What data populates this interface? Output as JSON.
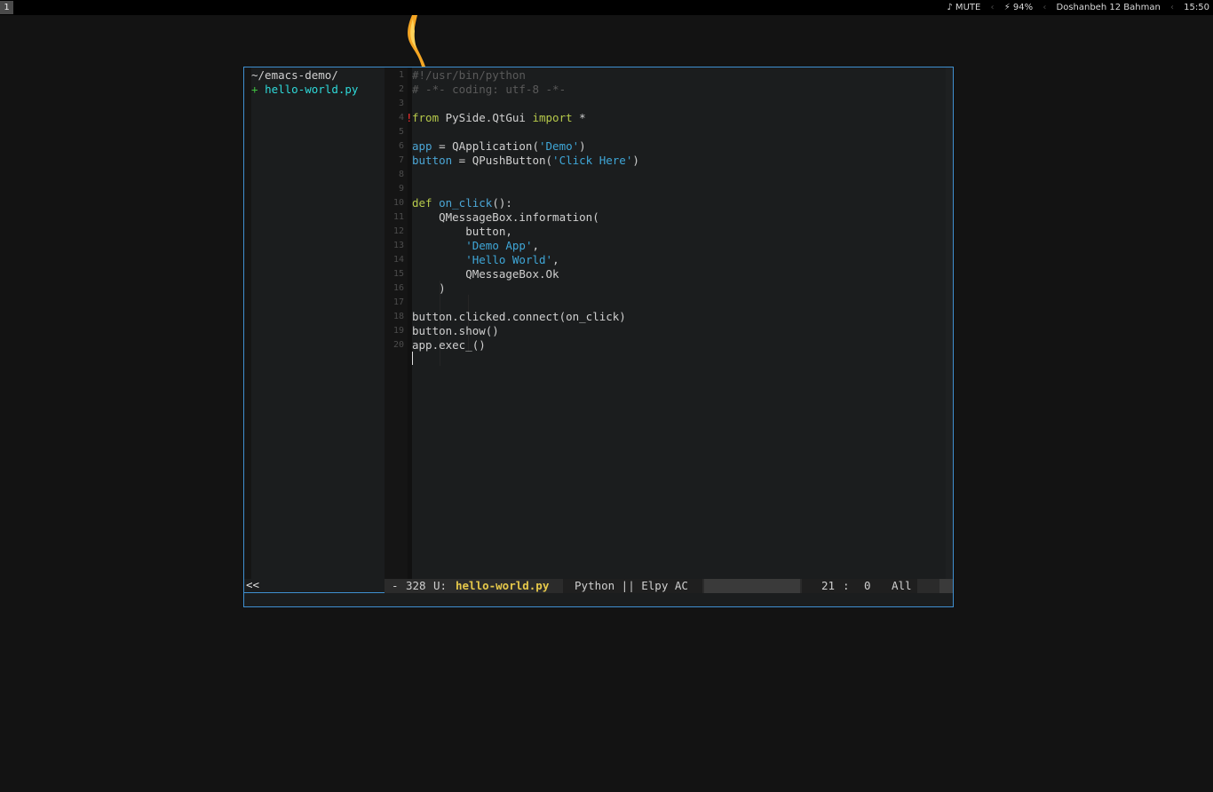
{
  "topbar": {
    "workspace": "1",
    "sound": "♪ MUTE",
    "battery": "⚡ 94%",
    "date": "Doshanbeh 12 Bahman",
    "time": "15:50",
    "separator": "‹"
  },
  "sidebar": {
    "path": "~/emacs-demo/",
    "file_marker": "+",
    "file_name": "hello-world.py",
    "toggle_label": "<<"
  },
  "editor": {
    "line_numbers": [
      "1",
      "2",
      "3",
      "4",
      "5",
      "6",
      "7",
      "8",
      "9",
      "10",
      "11",
      "12",
      "13",
      "14",
      "15",
      "16",
      "17",
      "18",
      "19",
      "20"
    ],
    "error_marker": "!",
    "lines": [
      {
        "parts": [
          {
            "t": "#!/usr/bin/python",
            "c": "cm"
          }
        ]
      },
      {
        "parts": [
          {
            "t": "# -*- coding: utf-8 -*-",
            "c": "cm"
          }
        ]
      },
      {
        "parts": []
      },
      {
        "parts": [
          {
            "t": "from",
            "c": "kw"
          },
          {
            "t": " PySide.QtGui ",
            "c": ""
          },
          {
            "t": "import",
            "c": "kw"
          },
          {
            "t": " *",
            "c": ""
          }
        ]
      },
      {
        "parts": []
      },
      {
        "parts": [
          {
            "t": "app",
            "c": "fn"
          },
          {
            "t": " = QApplication(",
            "c": ""
          },
          {
            "t": "'Demo'",
            "c": "str"
          },
          {
            "t": ")",
            "c": ""
          }
        ]
      },
      {
        "parts": [
          {
            "t": "button",
            "c": "fn"
          },
          {
            "t": " = QPushButton(",
            "c": ""
          },
          {
            "t": "'Click Here'",
            "c": "str"
          },
          {
            "t": ")",
            "c": ""
          }
        ]
      },
      {
        "parts": []
      },
      {
        "parts": []
      },
      {
        "parts": [
          {
            "t": "def",
            "c": "kw"
          },
          {
            "t": " ",
            "c": ""
          },
          {
            "t": "on_click",
            "c": "fn"
          },
          {
            "t": "():",
            "c": ""
          }
        ]
      },
      {
        "parts": [
          {
            "t": "    QMessageBox.information(",
            "c": ""
          }
        ]
      },
      {
        "parts": [
          {
            "t": "        button,",
            "c": ""
          }
        ]
      },
      {
        "parts": [
          {
            "t": "        ",
            "c": ""
          },
          {
            "t": "'Demo App'",
            "c": "str"
          },
          {
            "t": ",",
            "c": ""
          }
        ]
      },
      {
        "parts": [
          {
            "t": "        ",
            "c": ""
          },
          {
            "t": "'Hello World'",
            "c": "str"
          },
          {
            "t": ",",
            "c": ""
          }
        ]
      },
      {
        "parts": [
          {
            "t": "        QMessageBox.Ok",
            "c": ""
          }
        ]
      },
      {
        "parts": [
          {
            "t": "    )",
            "c": ""
          }
        ]
      },
      {
        "parts": []
      },
      {
        "parts": [
          {
            "t": "button.clicked.connect(on_click)",
            "c": ""
          }
        ]
      },
      {
        "parts": [
          {
            "t": "button.show()",
            "c": ""
          }
        ]
      },
      {
        "parts": [
          {
            "t": "app.exec_()",
            "c": ""
          }
        ]
      }
    ]
  },
  "modeline": {
    "modified": "-",
    "size": "328",
    "encoding": "U:",
    "buffer": "hello-world.py",
    "modes": "Python || Elpy AC",
    "line": "21",
    "col_sep": ":",
    "column": "0",
    "position": "All"
  }
}
